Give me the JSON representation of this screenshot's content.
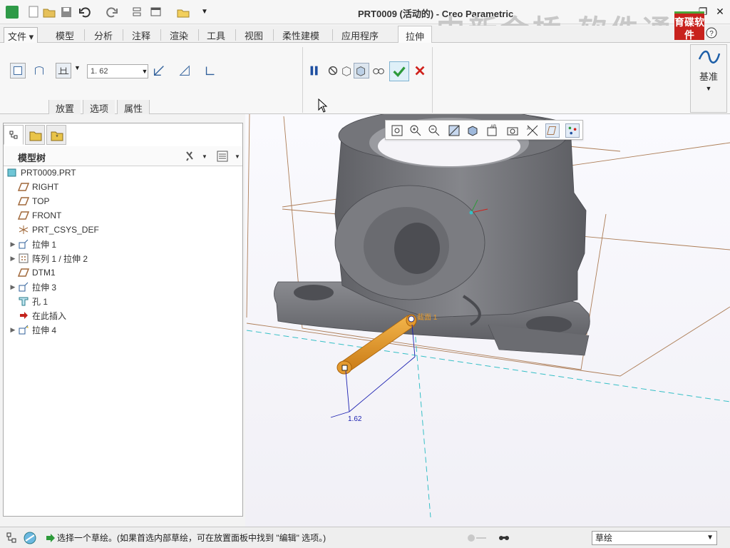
{
  "window": {
    "title": "PRT0009 (活动的) - Creo Parametric",
    "watermark": "中新金桥 软件通",
    "logo_text": "育碟软件"
  },
  "ribbon_tabs": [
    {
      "label": "文件"
    },
    {
      "label": "模型"
    },
    {
      "label": "分析"
    },
    {
      "label": "注释"
    },
    {
      "label": "渲染"
    },
    {
      "label": "工具"
    },
    {
      "label": "视图"
    },
    {
      "label": "柔性建模"
    },
    {
      "label": "应用程序"
    },
    {
      "label": "拉伸"
    }
  ],
  "extrude": {
    "depth_value": "1. 62",
    "subtabs": [
      "放置",
      "选项",
      "属性"
    ],
    "datum_label": "基准"
  },
  "model_tree": {
    "title": "模型树",
    "items": [
      {
        "label": "PRT0009.PRT"
      },
      {
        "label": "RIGHT"
      },
      {
        "label": "TOP"
      },
      {
        "label": "FRONT"
      },
      {
        "label": "PRT_CSYS_DEF"
      },
      {
        "label": "拉伸 1"
      },
      {
        "label": "阵列 1 / 拉伸 2"
      },
      {
        "label": "DTM1"
      },
      {
        "label": "拉伸 3"
      },
      {
        "label": "孔 1"
      },
      {
        "label": "在此插入"
      },
      {
        "label": "拉伸 4"
      }
    ]
  },
  "viewport": {
    "dimension_label": "1.62",
    "section_label": "截面 1"
  },
  "status": {
    "message": "选择一个草绘。(如果首选内部草绘，可在放置面板中找到 \"编辑\" 选项。)",
    "filter_value": "草绘"
  },
  "colors": {
    "accent_orange": "#e39a2f",
    "confirm_green": "#2d9a3a",
    "cancel_red": "#d0211c",
    "pause_blue": "#1e4fa1",
    "datum_plane_brown": "#a0683a",
    "axis_cyan": "#35bfc6"
  }
}
